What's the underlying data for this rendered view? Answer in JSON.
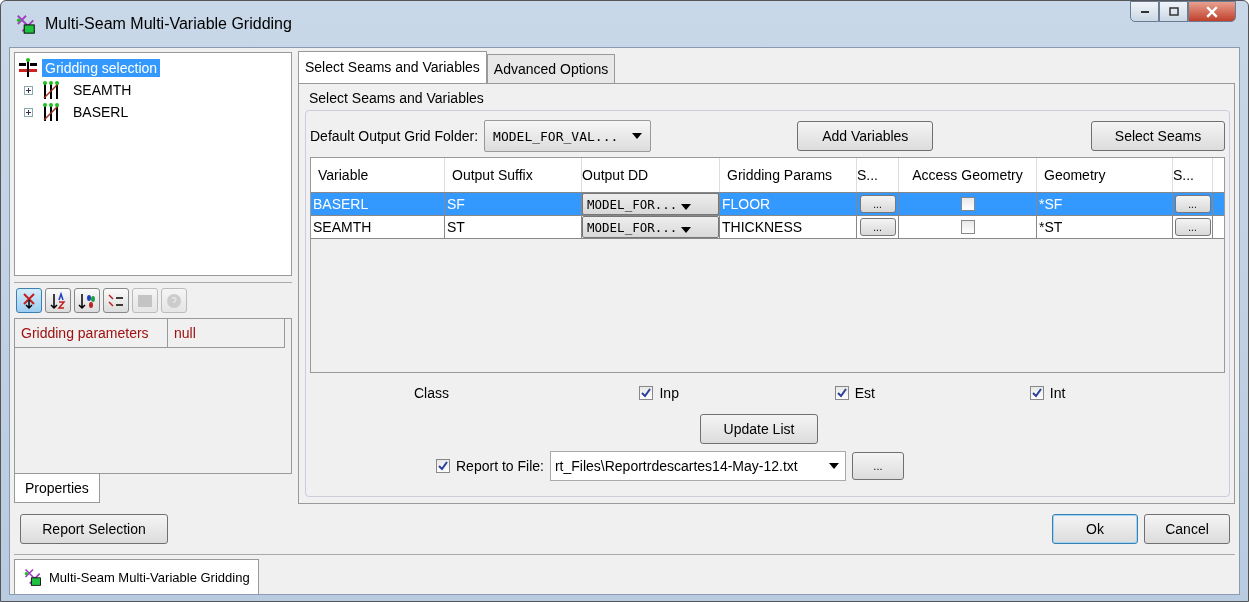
{
  "window": {
    "title": "Multi-Seam Multi-Variable Gridding"
  },
  "tree": {
    "label": "Gridding selection",
    "selected": true,
    "children": [
      {
        "label": "SEAMTH",
        "expanded": false
      },
      {
        "label": "BASERL",
        "expanded": false
      }
    ]
  },
  "toolbar": [
    {
      "kind": "categorize",
      "selected": true,
      "disabled": false
    },
    {
      "kind": "sort",
      "selected": false,
      "disabled": false
    },
    {
      "kind": "filter",
      "selected": false,
      "disabled": false
    },
    {
      "kind": "checklist",
      "selected": false,
      "disabled": false
    },
    {
      "kind": "grid",
      "selected": false,
      "disabled": true
    },
    {
      "kind": "help",
      "selected": false,
      "disabled": true
    }
  ],
  "properties": [
    {
      "name": "Gridding parameters",
      "value": "null"
    }
  ],
  "left_tabs": [
    {
      "label": "Properties",
      "selected": true
    }
  ],
  "tabs": [
    {
      "label": "Select Seams and Variables",
      "selected": true
    },
    {
      "label": "Advanced Options",
      "selected": false
    }
  ],
  "group": {
    "title": "Select Seams and Variables"
  },
  "folder": {
    "label": "Default Output Grid Folder:",
    "value": "MODEL_FOR_VAL..."
  },
  "top_buttons": [
    "Add Variables",
    "Select Seams"
  ],
  "table": {
    "columns": [
      "Variable",
      "Output Suffix",
      "Output DD",
      "Gridding Params",
      "S...",
      "Access Geometry",
      "Geometry",
      "S..."
    ],
    "rows": [
      {
        "selected": true,
        "variable": "BASERL",
        "suffix": "SF",
        "dd": "MODEL_FOR...",
        "params": "FLOOR",
        "params_button": "...",
        "access_geometry": false,
        "geometry": "*SF",
        "geometry_button": "..."
      },
      {
        "selected": false,
        "variable": "SEAMTH",
        "suffix": "ST",
        "dd": "MODEL_FOR...",
        "params": "THICKNESS",
        "params_button": "...",
        "access_geometry": false,
        "geometry": "*ST",
        "geometry_button": "..."
      }
    ]
  },
  "class": {
    "label": "Class",
    "options": [
      {
        "label": "Inp",
        "checked": true
      },
      {
        "label": "Est",
        "checked": true
      },
      {
        "label": "Int",
        "checked": true
      }
    ]
  },
  "update_button": "Update List",
  "report": {
    "checked": true,
    "label": "Report to File:",
    "value": "rt_Files\\Reportrdescartes14-May-12.txt",
    "browse": "..."
  },
  "footer": {
    "report_selection": "Report Selection",
    "ok": "Ok",
    "cancel": "Cancel"
  },
  "taskbar_tab": {
    "label": "Multi-Seam Multi-Variable Gridding"
  }
}
